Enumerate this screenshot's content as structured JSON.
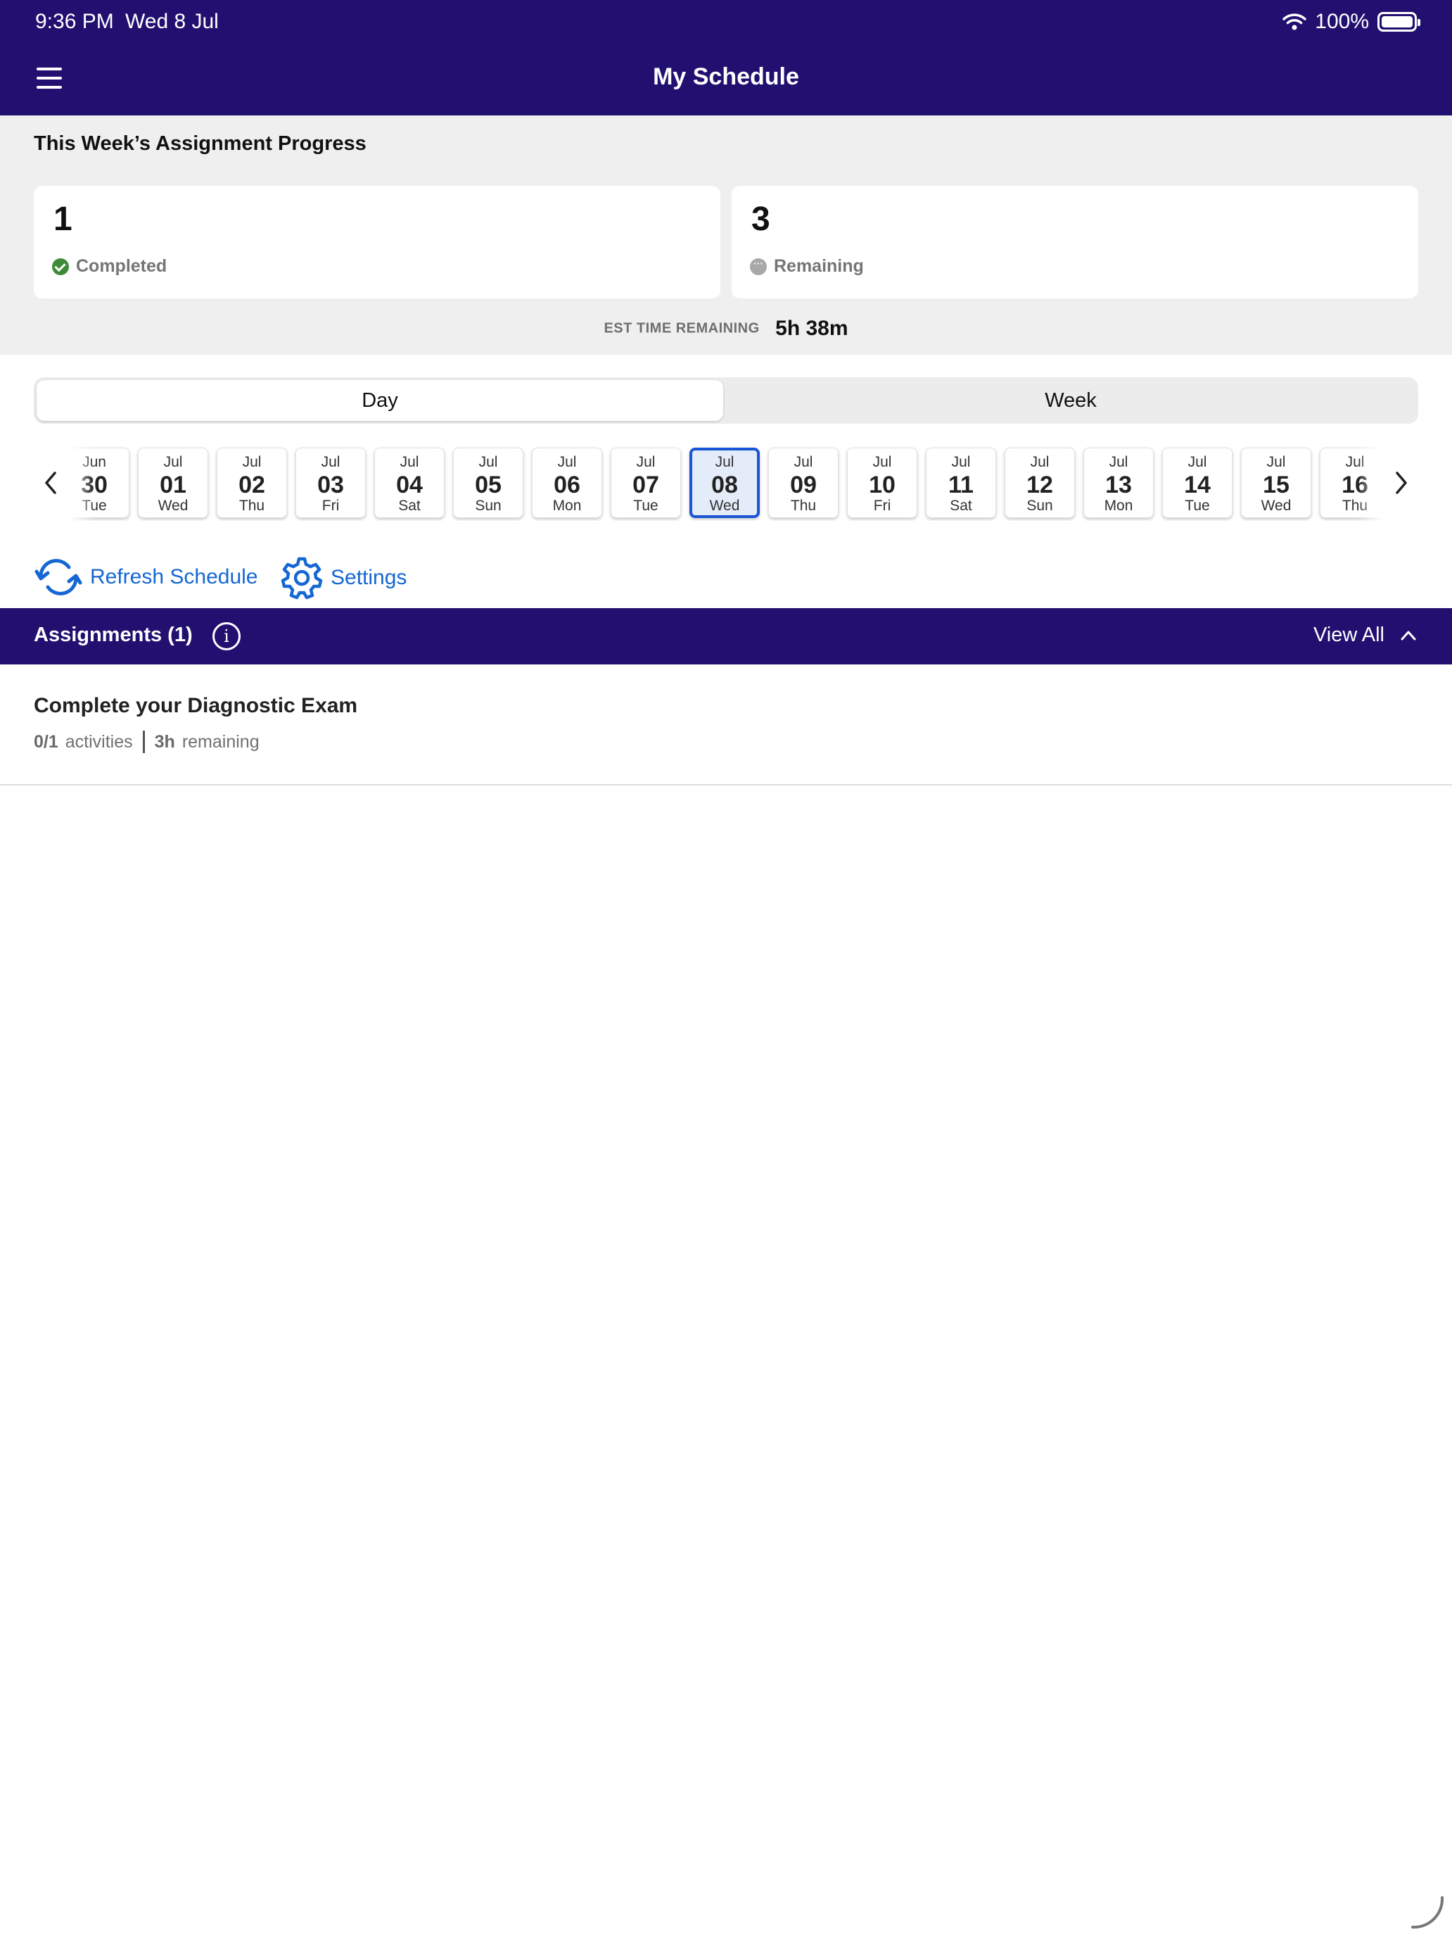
{
  "status_bar": {
    "time": "9:36 PM",
    "date": "Wed 8 Jul",
    "battery": "100%",
    "icons": [
      "wifi-icon",
      "battery-icon"
    ]
  },
  "nav": {
    "title": "My Schedule",
    "menu_icon": "menu-icon"
  },
  "progress": {
    "heading": "This Week’s Assignment Progress",
    "completed": {
      "count": "1",
      "label": "Completed",
      "icon": "check-circle-icon",
      "color": "#3d8b37"
    },
    "remaining": {
      "count": "3",
      "label": "Remaining",
      "icon": "ellipsis-circle-icon",
      "color": "#a8a8a8"
    },
    "est_label": "EST TIME REMAINING",
    "est_value": "5h 38m"
  },
  "view_toggle": {
    "options": [
      "Day",
      "Week"
    ],
    "selected": "Day"
  },
  "date_strip": {
    "selected_index": 8,
    "dates": [
      {
        "month": "Jun",
        "day": "30",
        "weekday": "Tue"
      },
      {
        "month": "Jul",
        "day": "01",
        "weekday": "Wed"
      },
      {
        "month": "Jul",
        "day": "02",
        "weekday": "Thu"
      },
      {
        "month": "Jul",
        "day": "03",
        "weekday": "Fri"
      },
      {
        "month": "Jul",
        "day": "04",
        "weekday": "Sat"
      },
      {
        "month": "Jul",
        "day": "05",
        "weekday": "Sun"
      },
      {
        "month": "Jul",
        "day": "06",
        "weekday": "Mon"
      },
      {
        "month": "Jul",
        "day": "07",
        "weekday": "Tue"
      },
      {
        "month": "Jul",
        "day": "08",
        "weekday": "Wed"
      },
      {
        "month": "Jul",
        "day": "09",
        "weekday": "Thu"
      },
      {
        "month": "Jul",
        "day": "10",
        "weekday": "Fri"
      },
      {
        "month": "Jul",
        "day": "11",
        "weekday": "Sat"
      },
      {
        "month": "Jul",
        "day": "12",
        "weekday": "Sun"
      },
      {
        "month": "Jul",
        "day": "13",
        "weekday": "Mon"
      },
      {
        "month": "Jul",
        "day": "14",
        "weekday": "Tue"
      },
      {
        "month": "Jul",
        "day": "15",
        "weekday": "Wed"
      },
      {
        "month": "Jul",
        "day": "16",
        "weekday": "Thu"
      }
    ]
  },
  "actions": {
    "refresh_label": "Refresh Schedule",
    "settings_label": "Settings",
    "accent_color": "#1567d3"
  },
  "assignments": {
    "header": "Assignments (1)",
    "view_all": "View All",
    "bar_color": "#221070",
    "items": [
      {
        "title": "Complete your Diagnostic Exam",
        "activities_count": "0/1",
        "activities_word": "activities",
        "time": "3h",
        "time_word": "remaining"
      }
    ]
  }
}
